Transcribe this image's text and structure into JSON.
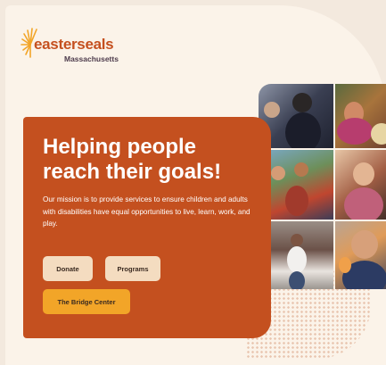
{
  "brand": {
    "name": "easterseals",
    "region": "Massachusetts",
    "logo_icon": "sunburst-icon",
    "accent_color": "#c4501f",
    "burst_color": "#f2a528"
  },
  "hero": {
    "title": "Helping people reach their goals!",
    "mission": "Our mission is to provide services to ensure children and adults with disabilities have equal opportunities to live, learn, work, and play.",
    "buttons": {
      "donate": "Donate",
      "programs": "Programs",
      "bridge_center": "The Bridge Center"
    }
  },
  "colors": {
    "hero_background": "#c4501f",
    "button_light": "#f4dcc0",
    "button_highlight": "#f2a528",
    "page_background": "#fbf3e9"
  }
}
